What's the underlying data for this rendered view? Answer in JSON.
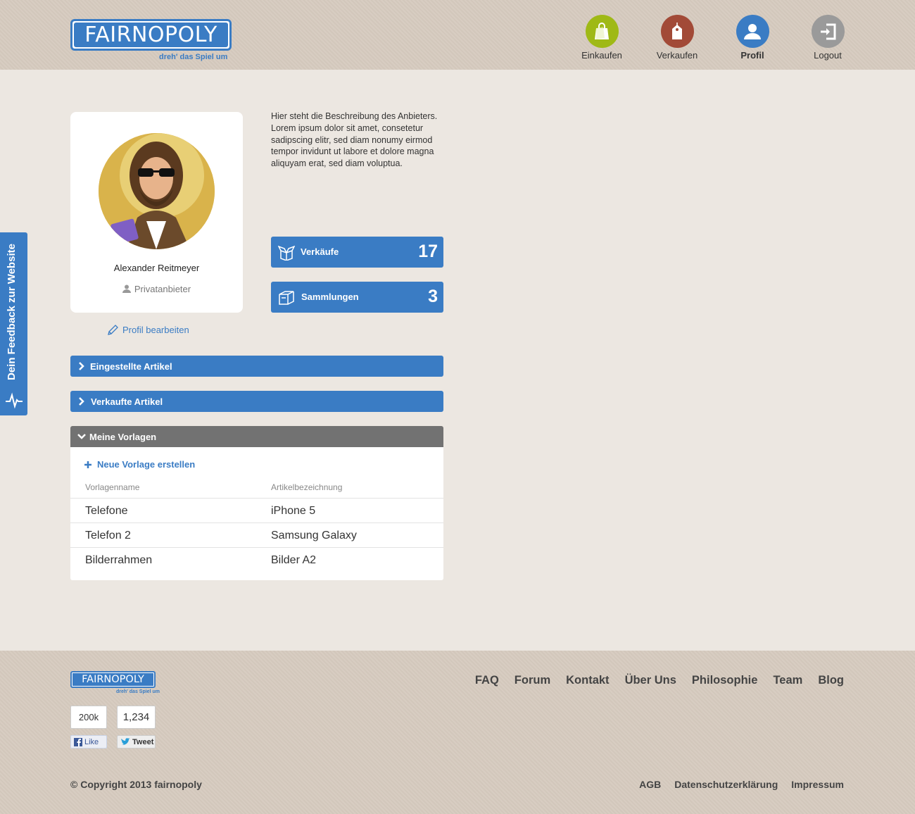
{
  "brand": {
    "logo_text": "FAIRNOPOLY",
    "tagline": "dreh' das Spiel um",
    "color": "#3a7cc4"
  },
  "nav": {
    "items": [
      {
        "label": "Einkaufen",
        "icon": "shopping-bag-icon",
        "color": "#9fb916"
      },
      {
        "label": "Verkaufen",
        "icon": "price-tag-icon",
        "color": "#a24a37"
      },
      {
        "label": "Profil",
        "icon": "user-icon",
        "color": "#3a7cc4",
        "active": true
      },
      {
        "label": "Logout",
        "icon": "logout-icon",
        "color": "#9a9a9a"
      }
    ]
  },
  "profile": {
    "name": "Alexander Reitmeyer",
    "type": "Privatanbieter",
    "edit_label": "Profil bearbeiten",
    "description": "Hier steht die Beschreibung des Anbi­eters. Lorem ipsum dolor sit amet, con­setetur sadipscing elitr, sed diam nonumy eirmod tempor invidunt ut labore et dolore magna aliquyam erat, sed diam voluptua."
  },
  "stats": [
    {
      "label": "Verkäufe",
      "value": "17",
      "icon": "open-box-icon"
    },
    {
      "label": "Sammlungen",
      "value": "3",
      "icon": "closed-box-icon"
    }
  ],
  "sections": [
    {
      "label": "Eingestellte Artikel",
      "expanded": false
    },
    {
      "label": "Verkaufte Artikel",
      "expanded": false
    },
    {
      "label": "Meine Vorlagen",
      "expanded": true
    }
  ],
  "templates": {
    "new_label": "Neue Vorlage erstellen",
    "columns": [
      "Vorlagenname",
      "Artikelbezeichnung"
    ],
    "rows": [
      {
        "name": "Telefone",
        "article": "iPhone 5"
      },
      {
        "name": "Telefon 2",
        "article": "Samsung Galaxy"
      },
      {
        "name": "Bilderrahmen",
        "article": "Bilder A2"
      }
    ]
  },
  "feedback": {
    "label": "Dein Feedback zur Website"
  },
  "footer": {
    "nav": [
      "FAQ",
      "Forum",
      "Kontakt",
      "Über Uns",
      "Philosophie",
      "Team",
      "Blog"
    ],
    "social": {
      "like_count": "200k",
      "like_label": "Like",
      "tweet_count": "1,234",
      "tweet_label": "Tweet"
    },
    "copyright": "© Copyright 2013 fairnopoly",
    "legal": [
      "AGB",
      "Datenschutzerklärung",
      "Impressum"
    ]
  }
}
